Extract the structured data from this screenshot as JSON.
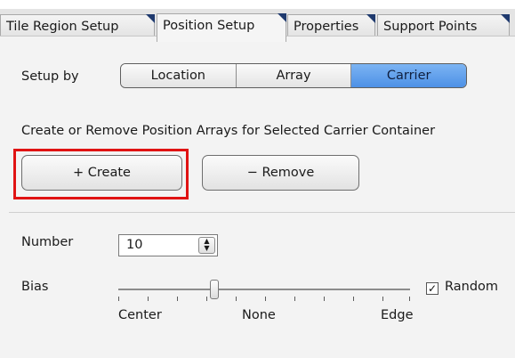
{
  "tabs": [
    {
      "label": "Tile Region Setup"
    },
    {
      "label": "Position Setup"
    },
    {
      "label": "Properties"
    },
    {
      "label": "Support Points"
    }
  ],
  "setup": {
    "label": "Setup by",
    "options": [
      "Location",
      "Array",
      "Carrier"
    ],
    "selected": "Carrier"
  },
  "description": "Create or Remove Position Arrays for Selected Carrier Container",
  "buttons": {
    "create_label": "+ Create",
    "remove_label": "− Remove"
  },
  "number": {
    "label": "Number",
    "value": "10"
  },
  "bias": {
    "label": "Bias",
    "value_fraction": 0.33,
    "tick_labels": [
      "Center",
      "None",
      "Edge"
    ]
  },
  "random": {
    "label": "Random",
    "checked": true
  },
  "colors": {
    "highlight": "#e01313",
    "selected_segment": "#5b9cef",
    "tab_corner": "#1f3a6e"
  }
}
